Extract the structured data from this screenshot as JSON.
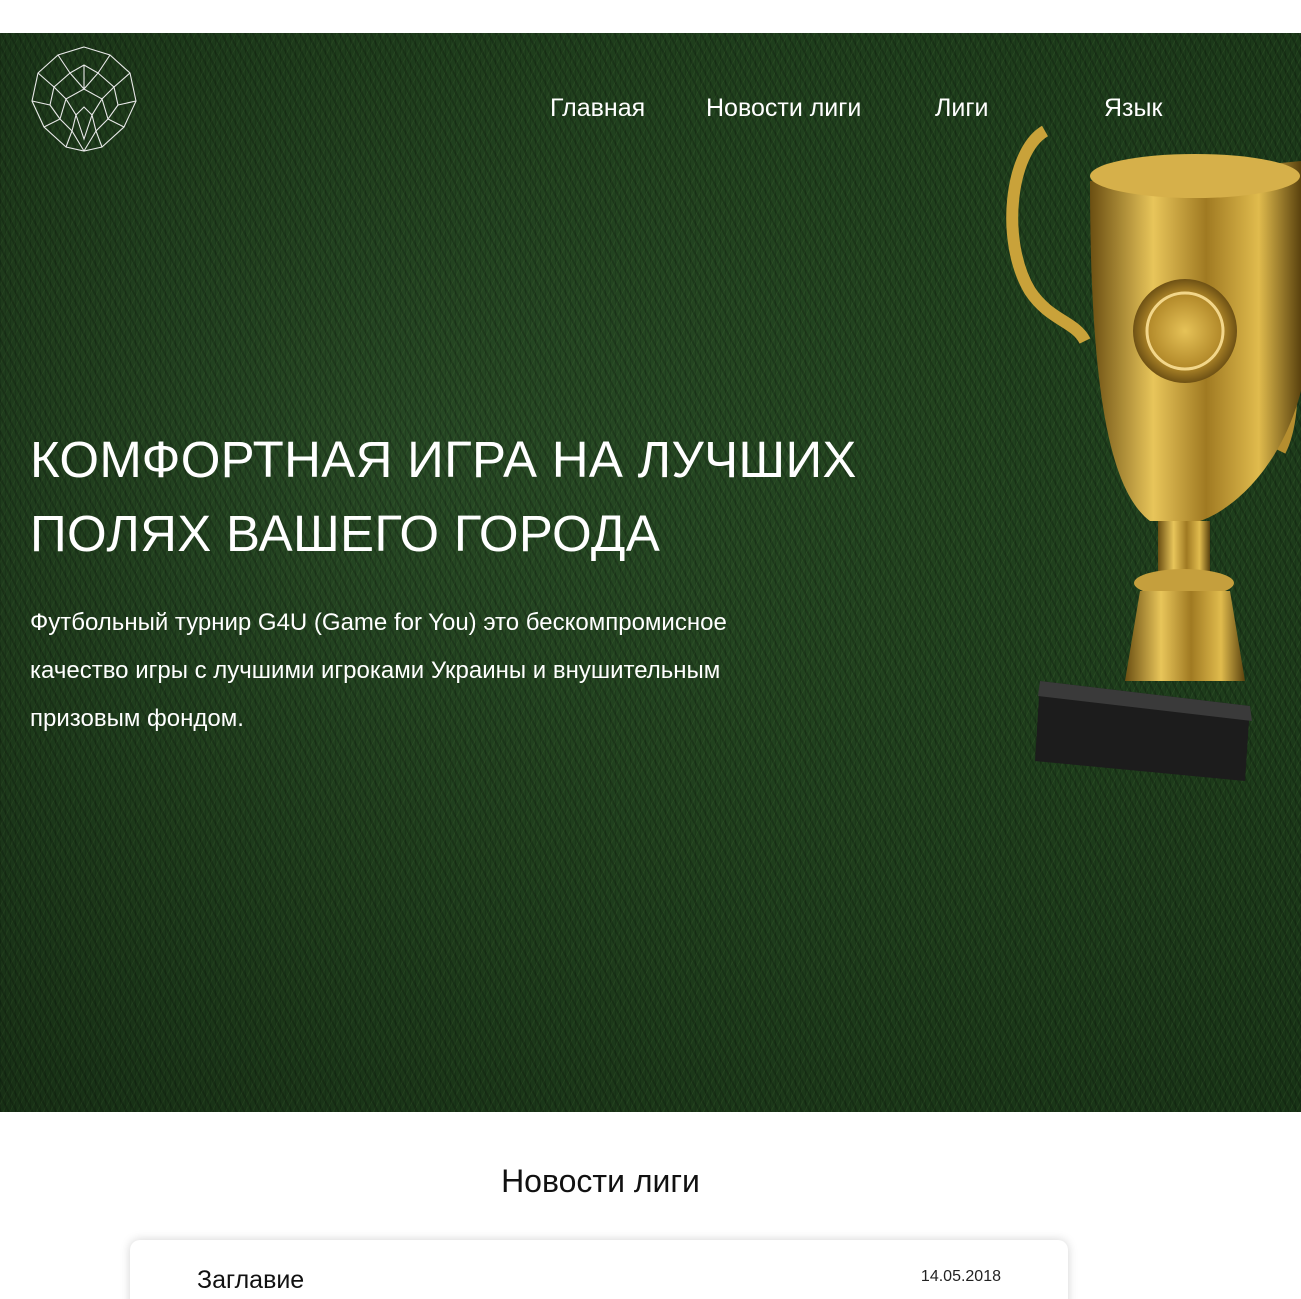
{
  "nav": {
    "items": [
      "Главная",
      "Новости лиги",
      "Лиги",
      "Язык"
    ]
  },
  "hero": {
    "headline_line1": "КОМФОРТНАЯ ИГРА НА ЛУЧШИХ",
    "headline_line2": "ПОЛЯХ ВАШЕГО ГОРОДА",
    "lead_line1": "Футбольный турнир G4U (Game for You) это бескомпромисное",
    "lead_line2": "качество игры с лучшими игроками Украины и внушительным",
    "lead_line3": "призовым фондом."
  },
  "news": {
    "section_title": "Новости лиги",
    "items": [
      {
        "title": "Заглавие",
        "date": "14.05.2018"
      }
    ]
  },
  "colors": {
    "hero_grass": "#22441f",
    "text_on_hero": "#ffffff",
    "trophy_gold": "#c9a23a"
  },
  "icons": {
    "logo": "geometric-lion-head-logo",
    "trophy": "gold-trophy-cup-image"
  }
}
